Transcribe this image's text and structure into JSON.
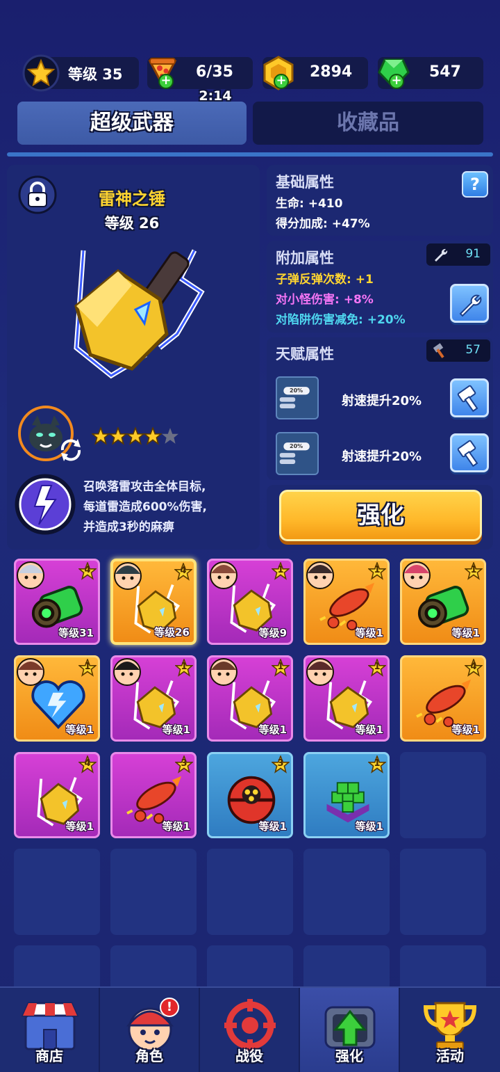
{
  "header": {
    "player_level": "等级 35",
    "energy": "6/35",
    "energy_timer": "2:14",
    "gold": "2894",
    "gems": "547"
  },
  "tabs": [
    {
      "label": "超级武器",
      "active": true
    },
    {
      "label": "收藏品",
      "active": false
    }
  ],
  "weapon": {
    "name": "雷神之锤",
    "level": "等级 26",
    "stars_filled": 4,
    "stars_total": 5,
    "skill_description": [
      "召唤落雷攻击全体目标,",
      "每道雷造成600%伤害,",
      "并造成3秒的麻痹"
    ]
  },
  "base_attributes": {
    "title": "基础属性",
    "lines": [
      "生命: +410",
      "得分加成: +47%"
    ]
  },
  "extra_attributes": {
    "title": "附加属性",
    "wrench_count": "91",
    "lines": [
      {
        "text": "子弹反弹次数: +1",
        "color": "#ffd530"
      },
      {
        "text": "对小怪伤害: +8%",
        "color": "#f575f5"
      },
      {
        "text": "对陷阱伤害减免: +20%",
        "color": "#4fd8f0"
      }
    ]
  },
  "talent_attributes": {
    "title": "天赋属性",
    "hammer_count": "57",
    "items": [
      {
        "text": "射速提升20%",
        "icon_label": "20%"
      },
      {
        "text": "射速提升20%",
        "icon_label": "20%"
      }
    ]
  },
  "upgrade_button": "强化",
  "inventory": [
    {
      "rarity": "purple",
      "level": "等级31",
      "stars": "4",
      "item": "green-cannon-icon",
      "char": "robot-avatar"
    },
    {
      "rarity": "orange",
      "level": "等级26",
      "stars": "4",
      "item": "thor-hammer-icon",
      "char": "panther-avatar",
      "selected": true
    },
    {
      "rarity": "purple",
      "level": "等级9",
      "stars": "1",
      "item": "thor-hammer-icon",
      "char": "girl-avatar"
    },
    {
      "rarity": "orange",
      "level": "等级1",
      "stars": "1",
      "item": "rocket-icon",
      "char": "hero-avatar"
    },
    {
      "rarity": "orange",
      "level": "等级1",
      "stars": "1",
      "item": "green-cannon-icon",
      "char": "punk-avatar"
    },
    {
      "rarity": "orange",
      "level": "等级1",
      "stars": "1",
      "item": "ice-heart-icon",
      "char": "bearded-avatar"
    },
    {
      "rarity": "purple",
      "level": "等级1",
      "stars": "1",
      "item": "thor-hammer-icon",
      "char": "ninja-avatar"
    },
    {
      "rarity": "purple",
      "level": "等级1",
      "stars": "1",
      "item": "thor-hammer-icon",
      "char": "sunglasses-avatar"
    },
    {
      "rarity": "purple",
      "level": "等级1",
      "stars": "1",
      "item": "thor-hammer-icon",
      "char": "pink-girl-avatar"
    },
    {
      "rarity": "orange",
      "level": "等级1",
      "stars": "4",
      "item": "rocket-icon",
      "char": ""
    },
    {
      "rarity": "purple",
      "level": "等级1",
      "stars": "4",
      "item": "thor-hammer-icon",
      "char": ""
    },
    {
      "rarity": "purple",
      "level": "等级1",
      "stars": "3",
      "item": "rocket-icon",
      "char": ""
    },
    {
      "rarity": "blue",
      "level": "等级1",
      "stars": "3",
      "item": "red-orb-icon",
      "char": ""
    },
    {
      "rarity": "blue",
      "level": "等级1",
      "stars": "1",
      "item": "green-cubes-icon",
      "char": ""
    }
  ],
  "nav": [
    {
      "label": "商店",
      "icon": "shop-icon"
    },
    {
      "label": "角色",
      "icon": "character-icon",
      "alert": "!"
    },
    {
      "label": "战役",
      "icon": "target-icon"
    },
    {
      "label": "强化",
      "icon": "upgrade-icon",
      "active": true
    },
    {
      "label": "活动",
      "icon": "trophy-icon"
    }
  ]
}
